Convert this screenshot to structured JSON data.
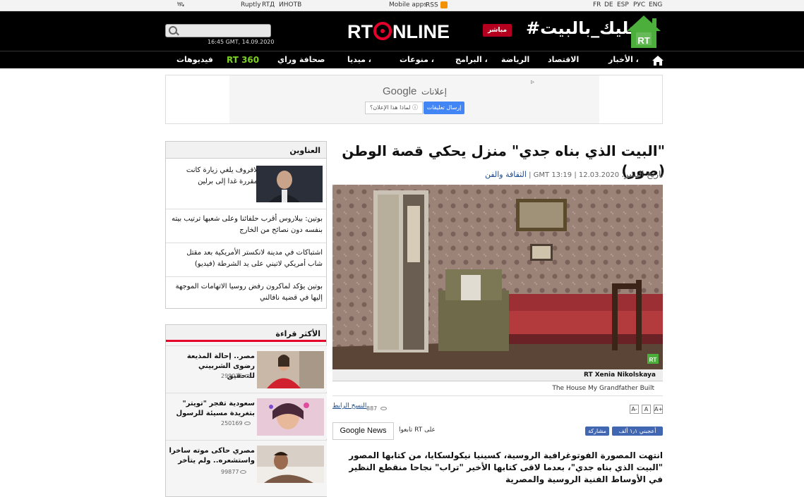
{
  "utility_bar": {
    "links": [
      "Ruptly",
      "RTД",
      "ИНОТВ"
    ],
    "mobile_apps": "Mobile apps",
    "rss": "RSS",
    "languages": [
      "FR",
      "DE",
      "ESP",
      "РУС",
      "ENG"
    ]
  },
  "header": {
    "datetime": "16:45 GMT, 14.09.2020",
    "logo_left": "RT",
    "logo_right": "NLINE",
    "live_label": "مباشر",
    "hashtag": "#خليك_بالبيت",
    "house_badge": "RT"
  },
  "nav": {
    "items": [
      "الأخبار ،",
      "الاقتصاد",
      "الرياضة",
      "البرامج ،",
      "منوعات ،",
      "ميديا ،",
      "صحافة وراي",
      "RT 360",
      "فيديوهات"
    ]
  },
  "ad": {
    "google": "Google",
    "label": "إعلانات",
    "send_feedback": "إرسال تعليقات",
    "why_ad": "لماذا هذا الإعلان؟ ⓘ"
  },
  "headlines": {
    "title": "العناوين",
    "items": [
      "لافروف يلغي زيارة كانت مقررة غدا إلى برلين",
      "بوتين: بيلاروس أقرب حلفائنا وعلى شعبها ترتيب بيته بنفسه دون نصائح من الخارج",
      "اشتباكات في مدينة لانكستر الأمريكية بعد مقتل شاب أمريكي لاتيني على يد الشرطة (فيديو)",
      "بوتين يؤكد لماكرون رفض روسيا الاتهامات الموجهة إليها في قضية نافالني"
    ]
  },
  "most_read": {
    "title": "الأكثر قراءة",
    "items": [
      {
        "text": "مصر.. إحالة المذيعة رضوى الشربيني للتحقيق",
        "views": "299025"
      },
      {
        "text": "سعودية تفجر \"تويتر\" بتغريدة مسيئة للرسول",
        "views": "250169"
      },
      {
        "text": "مصري حاكى موته ساخرا واستشعره.. ولم يتأخر",
        "views": "99877"
      }
    ]
  },
  "article": {
    "title": "\"البيت الذي بناه جدي\" منزل يحكي قصة الوطن (صور)",
    "published_label": "تاريخ النشر:",
    "published_value": "12.03.2020 | GMT 13:19 |",
    "category": "الثقافة والفن",
    "photo_badge": "RT",
    "credit": "RT Xenia Nikolskaya",
    "caption": "The House My Grandfather Built",
    "short_link": "النسخ الرابط",
    "views": "887",
    "font_sizes": [
      "A-",
      "A",
      "A+"
    ],
    "google_news": "Google News",
    "follow": "تابعوا RT على",
    "fb_like": "أعجبني ١٫١ ألف",
    "fb_share": "مشاركة",
    "lead": "انتهت المصورة الفوتوغرافية الروسية، كسينيا نيكولسكايا، من كتابها المصور \"البيت الذي بناه جدي\"، بعدما لاقى كتابها الأخير \"تراب\" نجاحا منقطع النظير في الأوساط الفنية الروسية والمصرية"
  },
  "colors": {
    "brand_red": "#e4002b",
    "header_black": "#000000",
    "rt360_green": "#7bd321",
    "house_green": "#4caf3b",
    "link_blue": "#1a4b8c"
  }
}
